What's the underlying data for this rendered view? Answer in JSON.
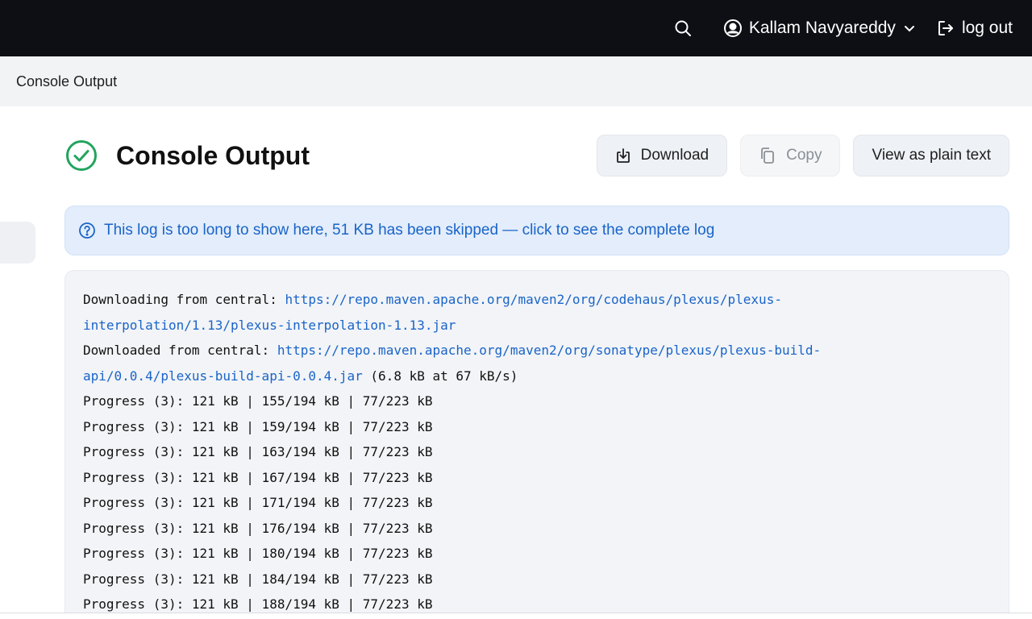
{
  "topbar": {
    "search_icon": "search-icon",
    "user_name": "Kallam Navyareddy",
    "logout_label": "log out"
  },
  "breadcrumb": {
    "current": "Console Output"
  },
  "page": {
    "title": "Console Output",
    "status": "success",
    "status_color": "#22a45d",
    "actions": {
      "download_label": "Download",
      "copy_label": "Copy",
      "plain_text_label": "View as plain text"
    }
  },
  "banner": {
    "text": "This log is too long to show here, 51 KB has been skipped — click to see the complete log"
  },
  "console": {
    "link_color": "#1a64c8",
    "lines": [
      {
        "prefix": "Downloading from central: ",
        "link": "https://repo.maven.apache.org/maven2/org/codehaus/plexus/plexus-",
        "suffix": ""
      },
      {
        "prefix": "",
        "link": "interpolation/1.13/plexus-interpolation-1.13.jar",
        "suffix": ""
      },
      {
        "prefix": "Downloaded from central: ",
        "link": "https://repo.maven.apache.org/maven2/org/sonatype/plexus/plexus-build-",
        "suffix": ""
      },
      {
        "prefix": "",
        "link": "api/0.0.4/plexus-build-api-0.0.4.jar",
        "suffix": " (6.8 kB at 67 kB/s)"
      },
      {
        "prefix": "Progress (3): 121 kB | 155/194 kB | 77/223 kB",
        "link": "",
        "suffix": ""
      },
      {
        "prefix": "Progress (3): 121 kB | 159/194 kB | 77/223 kB",
        "link": "",
        "suffix": ""
      },
      {
        "prefix": "Progress (3): 121 kB | 163/194 kB | 77/223 kB",
        "link": "",
        "suffix": ""
      },
      {
        "prefix": "Progress (3): 121 kB | 167/194 kB | 77/223 kB",
        "link": "",
        "suffix": ""
      },
      {
        "prefix": "Progress (3): 121 kB | 171/194 kB | 77/223 kB",
        "link": "",
        "suffix": ""
      },
      {
        "prefix": "Progress (3): 121 kB | 176/194 kB | 77/223 kB",
        "link": "",
        "suffix": ""
      },
      {
        "prefix": "Progress (3): 121 kB | 180/194 kB | 77/223 kB",
        "link": "",
        "suffix": ""
      },
      {
        "prefix": "Progress (3): 121 kB | 184/194 kB | 77/223 kB",
        "link": "",
        "suffix": ""
      },
      {
        "prefix": "Progress (3): 121 kB | 188/194 kB | 77/223 kB",
        "link": "",
        "suffix": ""
      }
    ]
  }
}
